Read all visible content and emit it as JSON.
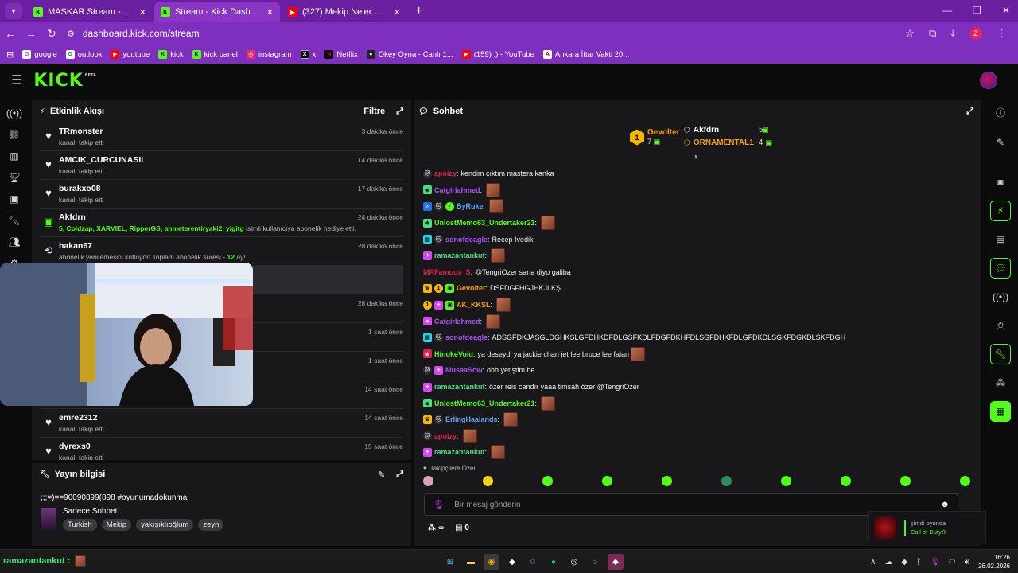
{
  "browser": {
    "tabs": [
      {
        "title": "MASKAR Stream - Watch Live o",
        "favicon": "kick-icon",
        "active": false
      },
      {
        "title": "Stream - Kick Dashboard",
        "favicon": "kick-icon",
        "active": true
      },
      {
        "title": "(327) Mekip Neler Neler 50.8ö",
        "favicon": "youtube-icon",
        "active": false
      }
    ],
    "url": "dashboard.kick.com/stream",
    "profile_initial": "Z",
    "bookmarks": [
      {
        "label": "google",
        "icon": "google-icon"
      },
      {
        "label": "outlook",
        "icon": "outlook-icon"
      },
      {
        "label": "youtube",
        "icon": "youtube-icon"
      },
      {
        "label": "kick",
        "icon": "kick-icon"
      },
      {
        "label": "kick panel",
        "icon": "kick-icon"
      },
      {
        "label": "instagram",
        "icon": "instagram-icon"
      },
      {
        "label": "x",
        "icon": "x-icon"
      },
      {
        "label": "Netflix",
        "icon": "netflix-icon"
      },
      {
        "label": "Okey Oyna - Canlı 1...",
        "icon": "okey-icon"
      },
      {
        "label": "(159) :) - YouTube",
        "icon": "youtube-icon"
      },
      {
        "label": "Ankara İftar Vakti 20...",
        "icon": "ankara-icon"
      }
    ]
  },
  "header": {
    "logo": "KICK",
    "logo_badge": "BETA"
  },
  "activity": {
    "title": "Etkinlik Akışı",
    "filter_label": "Filtre",
    "items": [
      {
        "user": "TRmonster",
        "text": "kanalı takip etti",
        "time": "3 dakika önce",
        "icon": "heart-icon"
      },
      {
        "user": "AMCIK_CURCUNASII",
        "text": "kanalı takip etti",
        "time": "14 dakika önce",
        "icon": "heart-icon"
      },
      {
        "user": "burakxo08",
        "text": "kanalı takip etti",
        "time": "17 dakika önce",
        "icon": "heart-icon"
      },
      {
        "user": "Akfdrn",
        "gift_prefix": "5, Coldzap, XARVIEL, RipperGS, ahmeterentiryaki2, yigitg",
        "text": " isimli kullanıcıya abonelik hediye etti.",
        "time": "24 dakika önce",
        "icon": "gift-sub-icon"
      },
      {
        "user": "hakan67",
        "text": "abonelik yenilemesini kutluyor! Toplam abonelik süresi - ",
        "months": "12",
        "months_suffix": " ay!",
        "time": "28 dakika önce",
        "icon": "renew-icon"
      },
      {
        "user": "",
        "text": "",
        "time": "",
        "icon": "",
        "highlight": true
      },
      {
        "user": "",
        "text": "",
        "time": "28 dakika önce",
        "icon": "heart-icon"
      },
      {
        "user": "",
        "text": "",
        "time": "1 saat önce",
        "icon": "heart-icon"
      },
      {
        "user": "",
        "text": "",
        "time": "1 saat önce",
        "icon": "heart-icon"
      },
      {
        "user": "",
        "text": "",
        "time": "14 saat önce",
        "icon": "heart-icon"
      },
      {
        "user": "emre2312",
        "text": "kanalı takip etti",
        "time": "14 saat önce",
        "icon": "heart-icon"
      },
      {
        "user": "dyrexs0",
        "text": "kanalı takip etti",
        "time": "15 saat önce",
        "icon": "heart-icon"
      }
    ]
  },
  "stream_info": {
    "title_label": "Yayın bilgisi",
    "stream_title": ";;;=)==90090899(898 #oyunumadokunma",
    "category": "Sadece Sohbet",
    "tags": [
      "Turkish",
      "Mekip",
      "yakışıklıoğlum",
      "zeyn"
    ]
  },
  "chat": {
    "title": "Sohbet",
    "leaderboard": [
      {
        "name": "Gevolter",
        "count": "7",
        "color": "#f59e0b"
      },
      {
        "name": "Akfdrn",
        "count": "5",
        "color": "#ffffff"
      },
      {
        "name": "ORNAMENTAL1",
        "count": "4",
        "color": "#f59e0b"
      }
    ],
    "messages": [
      {
        "badges": [
          "gift"
        ],
        "user": "apoizy",
        "color": "#e11d48",
        "text": "kendim çıktım mastera kanka",
        "emote": false
      },
      {
        "badges": [
          "sub"
        ],
        "user": "Catgirlahmed",
        "color": "#a855f7",
        "text": "",
        "emote": true
      },
      {
        "badges": [
          "mod",
          "gift",
          "ver"
        ],
        "user": "ByRuke",
        "color": "#60a5fa",
        "text": "",
        "emote": true
      },
      {
        "badges": [
          "sub"
        ],
        "user": "UnlostMemo63_Undertaker21",
        "color": "#53fc18",
        "text": "",
        "emote": true
      },
      {
        "badges": [
          "cyan",
          "gift"
        ],
        "user": "sonofdeagle",
        "color": "#a855f7",
        "text": "Recep İvedik",
        "emote": false
      },
      {
        "badges": [
          "pink"
        ],
        "user": "ramazantankut",
        "color": "#4ade80",
        "text": "",
        "emote": true
      },
      {
        "badges": [],
        "user": "MRFamous_S",
        "color": "#e11d48",
        "text": "@TengriOzer sana diyo galiba",
        "emote": false
      },
      {
        "badges": [
          "crown",
          "num",
          "grn"
        ],
        "user": "Gevolter",
        "color": "#f59e0b",
        "text": "DSFDGFHGJHKJLKŞ",
        "emote": false
      },
      {
        "badges": [
          "num",
          "pink",
          "grn"
        ],
        "user": "AK_KKSL",
        "color": "#f59e0b",
        "text": "",
        "emote": true
      },
      {
        "badges": [
          "pink"
        ],
        "user": "Catgirlahmed",
        "color": "#a855f7",
        "text": "",
        "emote": true
      },
      {
        "badges": [
          "cyan",
          "gift"
        ],
        "user": "sonofdeagle",
        "color": "#a855f7",
        "text": "ADSGFDKJASGLDGHKSLGFDHKDFDLGSFKDLFDGFDKHFDLSGFDHKFDLGFDKDLSGKFDGKDLSKFDGH",
        "emote": false
      },
      {
        "badges": [
          "vip"
        ],
        "user": "HinokeVoid",
        "color": "#53fc18",
        "text": "ya deseydi ya jackie chan jet lee bruce lee falan",
        "emote": true
      },
      {
        "badges": [
          "gift",
          "pink"
        ],
        "user": "MusaaSow",
        "color": "#a855f7",
        "text": "ohh yetiştim be",
        "emote": false
      },
      {
        "badges": [
          "pink"
        ],
        "user": "ramazantankut",
        "color": "#4ade80",
        "text": "özer reis candır yaaa timsah özer @TengriOzer",
        "emote": false
      },
      {
        "badges": [
          "sub"
        ],
        "user": "UnlostMemo63_Undertaker21",
        "color": "#53fc18",
        "text": "",
        "emote": true
      },
      {
        "badges": [
          "crown",
          "gift"
        ],
        "user": "ErlingHaalands",
        "color": "#60a5fa",
        "text": "",
        "emote": true
      },
      {
        "badges": [
          "gift"
        ],
        "user": "apoizy",
        "color": "#e11d48",
        "text": "",
        "emote": true
      },
      {
        "badges": [
          "pink"
        ],
        "user": "ramazantankut",
        "color": "#4ade80",
        "text": "",
        "emote": true
      }
    ],
    "emote_section_label": "Takipçilere Özel",
    "input_placeholder": "Bir mesaj gönderin",
    "points": "0"
  },
  "now_playing": {
    "line1": "şimdi oyunda",
    "line2": "Call of Duty®"
  },
  "taskbar": {
    "chat_user": "ramazantankut",
    "time": "16:26",
    "date": "26.02.2026"
  }
}
